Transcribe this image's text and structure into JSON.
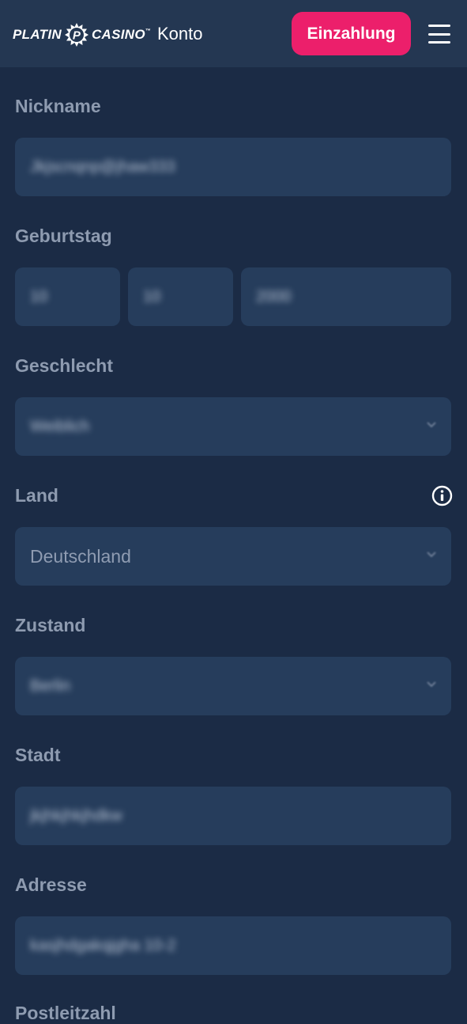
{
  "header": {
    "logo_left": "PLATIN",
    "logo_mark": "P",
    "logo_right": "CASINO",
    "logo_tm": "™",
    "title": "Konto",
    "deposit_label": "Einzahlung",
    "menu_icon": "hamburger-menu-icon"
  },
  "form": {
    "nickname": {
      "label": "Nickname",
      "value": "Jkjscnqnp@jhaw333"
    },
    "birthday": {
      "label": "Geburtstag",
      "day": "10",
      "month": "10",
      "year": "2000"
    },
    "gender": {
      "label": "Geschlecht",
      "value": "Weiblich"
    },
    "country": {
      "label": "Land",
      "value": "Deutschland",
      "info_icon": "info-icon"
    },
    "state": {
      "label": "Zustand",
      "value": "Berlin"
    },
    "city": {
      "label": "Stadt",
      "value": "jkjhkjhkjhdkw"
    },
    "address": {
      "label": "Adresse",
      "value": "kasjhdgakqjgha 10-2"
    },
    "postal": {
      "label": "Postleitzahl"
    }
  },
  "colors": {
    "background": "#1b2b45",
    "header": "#243752",
    "field": "#263d5c",
    "accent": "#ec1f6b",
    "label": "#8e9bb0"
  }
}
